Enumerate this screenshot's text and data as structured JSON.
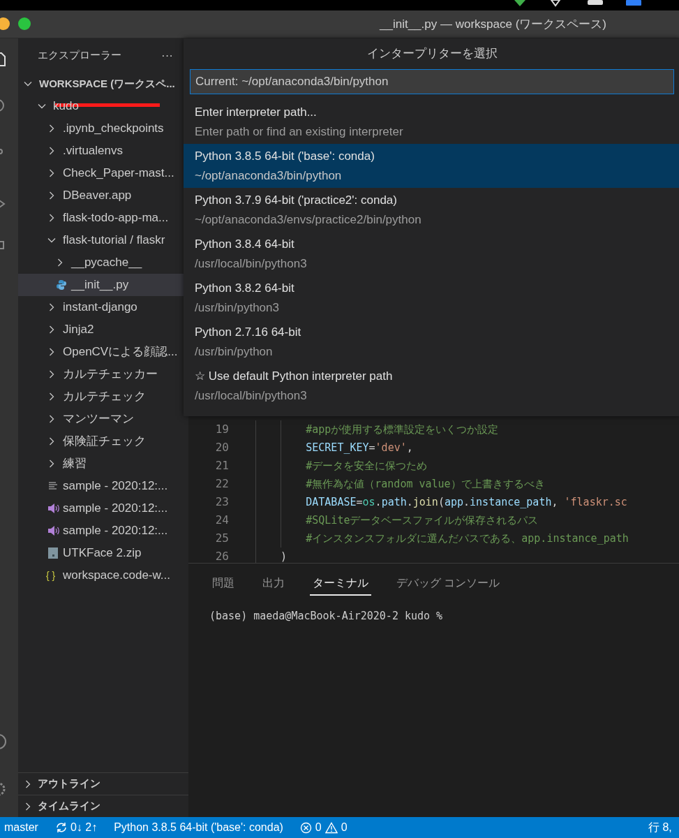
{
  "window": {
    "title": "__init__.py — workspace (ワークスペース)"
  },
  "explorer": {
    "title": "エクスプローラー",
    "more": "···",
    "tree": [
      {
        "label": "WORKSPACE (ワークスペ...",
        "kind": "root",
        "expanded": true,
        "children": [
          {
            "label": "kudo",
            "kind": "folder",
            "expanded": true,
            "redacted": true,
            "children": [
              {
                "label": ".ipynb_checkpoints",
                "kind": "folder",
                "expanded": false
              },
              {
                "label": ".virtualenvs",
                "kind": "folder",
                "expanded": false
              },
              {
                "label": "Check_Paper-mast...",
                "kind": "folder",
                "expanded": false
              },
              {
                "label": "DBeaver.app",
                "kind": "folder",
                "expanded": false
              },
              {
                "label": "flask-todo-app-ma...",
                "kind": "folder",
                "expanded": false
              },
              {
                "label": "flask-tutorial / flaskr",
                "kind": "folder",
                "expanded": true,
                "children": [
                  {
                    "label": "__pycache__",
                    "kind": "folder",
                    "expanded": false
                  },
                  {
                    "label": "__init__.py",
                    "kind": "python",
                    "selected": true
                  }
                ]
              },
              {
                "label": "instant-django",
                "kind": "folder",
                "expanded": false
              },
              {
                "label": "Jinja2",
                "kind": "folder",
                "expanded": false
              },
              {
                "label": "OpenCVによる顔認...",
                "kind": "folder",
                "expanded": false
              },
              {
                "label": "カルテチェッカー",
                "kind": "folder",
                "expanded": false
              },
              {
                "label": "カルテチェック",
                "kind": "folder",
                "expanded": false
              },
              {
                "label": "マンツーマン",
                "kind": "folder",
                "expanded": false
              },
              {
                "label": "保険証チェック",
                "kind": "folder",
                "expanded": false
              },
              {
                "label": "練習",
                "kind": "folder",
                "expanded": false
              },
              {
                "label": "sample - 2020:12:...",
                "kind": "text"
              },
              {
                "label": "sample - 2020:12:...",
                "kind": "audio"
              },
              {
                "label": "sample - 2020:12:...",
                "kind": "audio"
              },
              {
                "label": "UTKFace 2.zip",
                "kind": "zip"
              },
              {
                "label": "workspace.code-w...",
                "kind": "json",
                "icon_text": "{ }"
              }
            ]
          }
        ]
      }
    ],
    "sections": [
      {
        "label": "アウトライン",
        "expanded": false
      },
      {
        "label": "タイムライン",
        "expanded": false
      }
    ]
  },
  "quick_pick": {
    "title": "インタープリターを選択",
    "value": "Current: ~/opt/anaconda3/bin/python",
    "items": [
      {
        "label": "Enter interpreter path...",
        "detail": "Enter path or find an existing interpreter",
        "selected": false
      },
      {
        "label": "Python 3.8.5 64-bit ('base': conda)",
        "detail": "~/opt/anaconda3/bin/python",
        "selected": true
      },
      {
        "label": "Python 3.7.9 64-bit ('practice2': conda)",
        "detail": "~/opt/anaconda3/envs/practice2/bin/python",
        "selected": false
      },
      {
        "label": "Python 3.8.4 64-bit",
        "detail": "/usr/local/bin/python3",
        "selected": false
      },
      {
        "label": "Python 3.8.2 64-bit",
        "detail": "/usr/bin/python3",
        "selected": false
      },
      {
        "label": "Python 2.7.16 64-bit",
        "detail": "/usr/bin/python",
        "selected": false
      },
      {
        "label": "☆ Use default Python interpreter path",
        "detail": "/usr/local/bin/python3",
        "selected": false
      }
    ]
  },
  "editor": {
    "lines": [
      {
        "number": "19",
        "tokens": [
          {
            "text": "        #appが使用する標準設定をいくつか設定",
            "kind": "comment"
          }
        ]
      },
      {
        "number": "20",
        "tokens": [
          {
            "text": "        SECRET_KEY",
            "kind": "variable"
          },
          {
            "text": "=",
            "kind": "plain"
          },
          {
            "text": "'dev'",
            "kind": "string"
          },
          {
            "text": ",",
            "kind": "plain"
          }
        ]
      },
      {
        "number": "21",
        "tokens": [
          {
            "text": "        #データを安全に保つため",
            "kind": "comment"
          }
        ]
      },
      {
        "number": "22",
        "tokens": [
          {
            "text": "        #無作為な値（random value）で上書きするべき",
            "kind": "comment"
          }
        ]
      },
      {
        "number": "23",
        "tokens": [
          {
            "text": "        DATABASE",
            "kind": "variable"
          },
          {
            "text": "=",
            "kind": "plain"
          },
          {
            "text": "os",
            "kind": "module"
          },
          {
            "text": ".",
            "kind": "plain"
          },
          {
            "text": "path",
            "kind": "variable"
          },
          {
            "text": ".",
            "kind": "plain"
          },
          {
            "text": "join",
            "kind": "function"
          },
          {
            "text": "(",
            "kind": "plain"
          },
          {
            "text": "app",
            "kind": "variable"
          },
          {
            "text": ".",
            "kind": "plain"
          },
          {
            "text": "instance_path",
            "kind": "variable"
          },
          {
            "text": ", ",
            "kind": "plain"
          },
          {
            "text": "'flaskr.sc",
            "kind": "string"
          }
        ]
      },
      {
        "number": "24",
        "tokens": [
          {
            "text": "        #SQLiteデータベースファイルが保存されるパス",
            "kind": "comment"
          }
        ]
      },
      {
        "number": "25",
        "tokens": [
          {
            "text": "        #インスタンスフォルダに選んだパスである、app.instance_path",
            "kind": "comment"
          }
        ]
      },
      {
        "number": "26",
        "tokens": [
          {
            "text": "    )",
            "kind": "plain"
          }
        ]
      }
    ]
  },
  "panel": {
    "tabs": [
      {
        "label": "問題",
        "selected": false
      },
      {
        "label": "出力",
        "selected": false
      },
      {
        "label": "ターミナル",
        "selected": true
      },
      {
        "label": "デバッグ コンソール",
        "selected": false
      }
    ],
    "terminal": [
      "(base) maeda@MacBook-Air2020-2 kudo %"
    ]
  },
  "status_bar": {
    "branch": "master",
    "sync": "0↓ 2↑",
    "interpreter": "Python 3.8.5 64-bit ('base': conda)",
    "errors": "0",
    "warnings": "0",
    "position": "行 8,"
  }
}
